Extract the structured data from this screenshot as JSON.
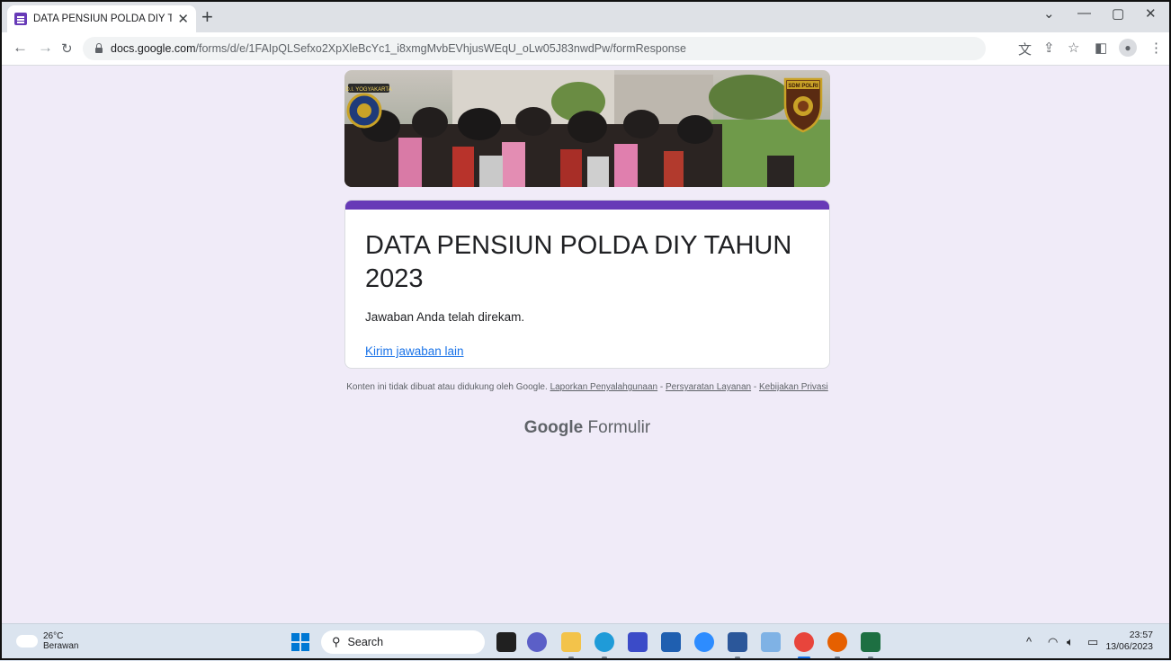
{
  "browser": {
    "tab_title": "DATA PENSIUN POLDA DIY TAHU",
    "tab_close": "✕",
    "new_tab": "+",
    "url_host": "docs.google.com",
    "url_path": "/forms/d/e/1FAIpQLSefxo2XpXleBcYc1_i8xmgMvbEVhjusWEqU_oLw05J83nwdPw/formResponse"
  },
  "form": {
    "title": "DATA PENSIUN POLDA DIY TAHUN 2023",
    "message": "Jawaban Anda telah direkam.",
    "link": "Kirim jawaban lain",
    "banner_left_badge": "D.I. YOGYAKARTA",
    "banner_right_badge": "SDM POLRI"
  },
  "footer": {
    "text": "Konten ini tidak dibuat atau didukung oleh Google.",
    "report": "Laporkan Penyalahgunaan",
    "terms": "Persyaratan Layanan",
    "privacy": "Kebijakan Privasi",
    "sep": "-",
    "brand_google": "Google",
    "brand_product": "Formulir"
  },
  "taskbar": {
    "temperature": "26°C",
    "weather": "Berawan",
    "search_label": "Search",
    "time": "23:57",
    "date": "13/06/2023"
  },
  "colors": {
    "form_accent": "#673ab7",
    "page_bg": "#f0ebf8",
    "link": "#1a73e8"
  }
}
